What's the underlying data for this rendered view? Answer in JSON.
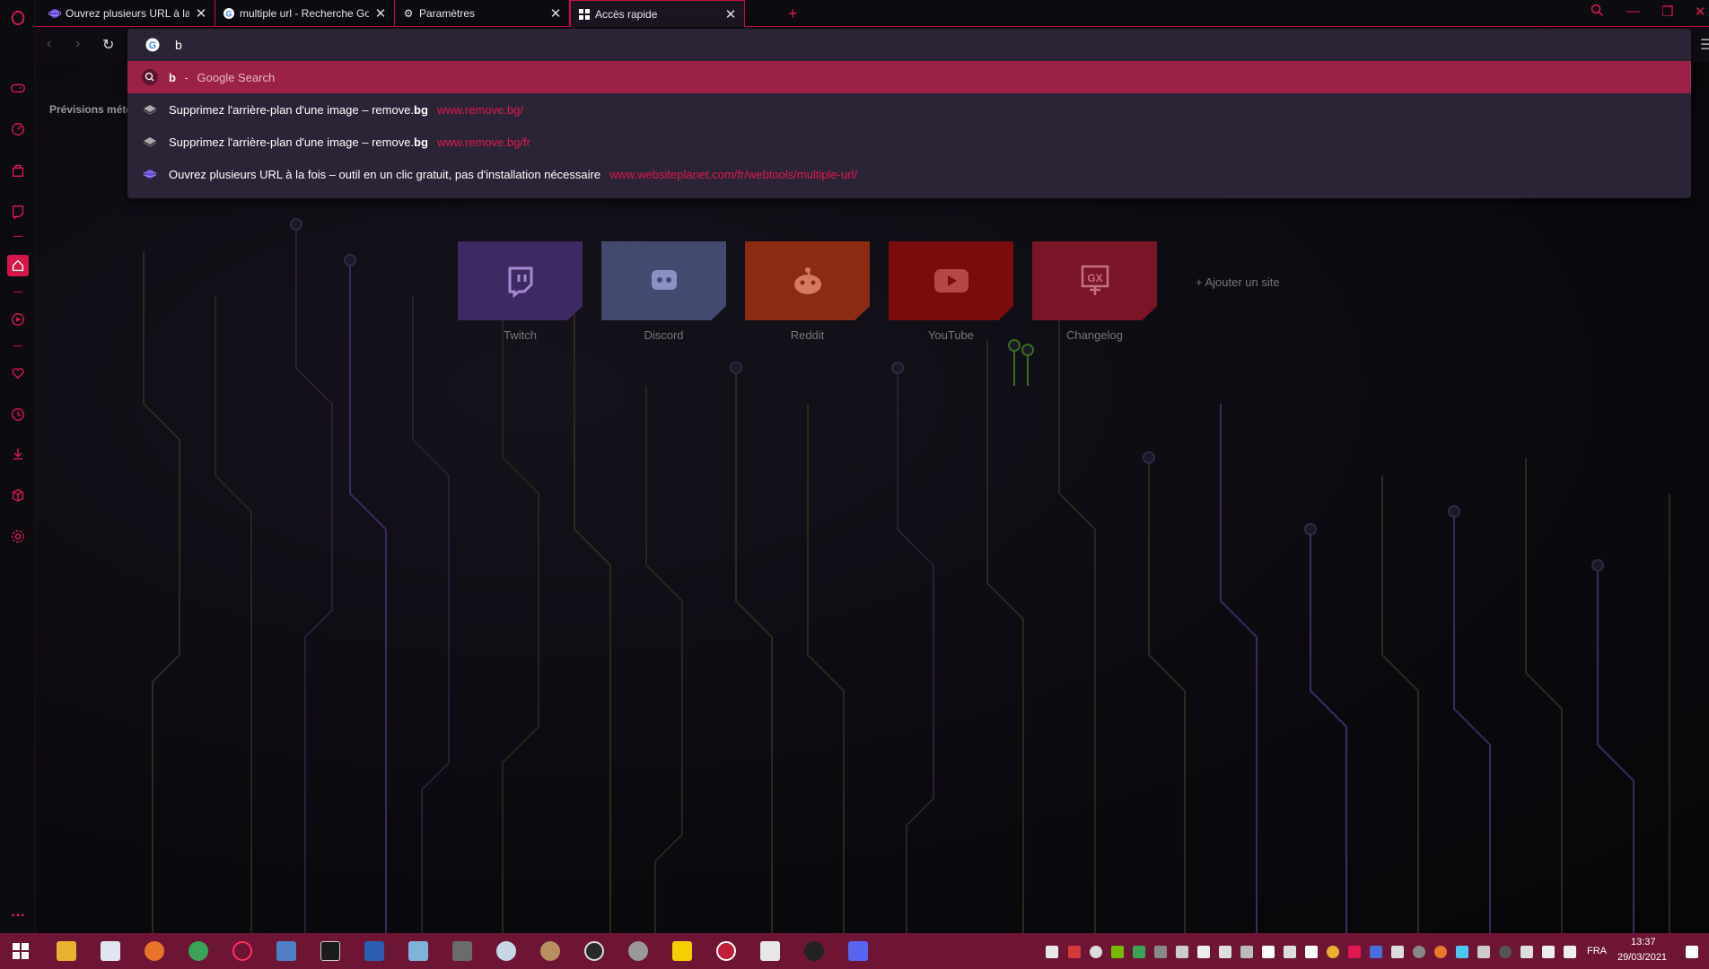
{
  "tabs": [
    {
      "title": "Ouvrez plusieurs URL à la f",
      "favicon": "websiteplanet-icon"
    },
    {
      "title": "multiple url - Recherche Go",
      "favicon": "google-icon"
    },
    {
      "title": "Paramètres",
      "favicon": "gear-icon"
    },
    {
      "title": "Accès rapide",
      "favicon": "grid-icon",
      "active": true
    }
  ],
  "new_tab_label": "+",
  "window_controls": {
    "search": "search-icon",
    "minimize": "—",
    "restore": "❐",
    "close": "✕"
  },
  "omnibox": {
    "value": "b",
    "suggestions": [
      {
        "bold": "b",
        "sep": " - ",
        "rest": "Google Search",
        "type": "search",
        "icon": "search-icon"
      },
      {
        "text": "Supprimez l'arrière-plan d'une image – remove.",
        "bold": "bg",
        "url": "www.remove.bg/",
        "icon": "remove-bg-icon"
      },
      {
        "text": "Supprimez l'arrière-plan d'une image – remove.",
        "bold": "bg",
        "url": "www.remove.bg/fr",
        "icon": "remove-bg-icon"
      },
      {
        "text": "Ouvrez plusieurs URL à la fois – outil en un clic gratuit, pas d'installation nécessaire",
        "bold": "",
        "url": "www.websiteplanet.com/fr/webtools/multiple-url/",
        "icon": "websiteplanet-icon"
      }
    ]
  },
  "weather_label": "Prévisions mété",
  "speed_dials": [
    {
      "label": "Twitch",
      "color": "#3e2a63",
      "icon": "twitch-icon"
    },
    {
      "label": "Discord",
      "color": "#434a70",
      "icon": "discord-icon"
    },
    {
      "label": "Reddit",
      "color": "#8a2b12",
      "icon": "reddit-icon"
    },
    {
      "label": "YouTube",
      "color": "#7a0c0c",
      "icon": "youtube-icon"
    },
    {
      "label": "Changelog",
      "color": "#7a1528",
      "icon": "gx-icon"
    }
  ],
  "add_site_label": "+ Ajouter un site",
  "taskbar": {
    "language": "FRA",
    "time": "13:37",
    "date": "29/03/2021"
  },
  "colors": {
    "accent": "#e0194f",
    "omnibox_bg": "#2b2436",
    "selected_row": "#9c2147",
    "taskbar": "#6e1536"
  }
}
